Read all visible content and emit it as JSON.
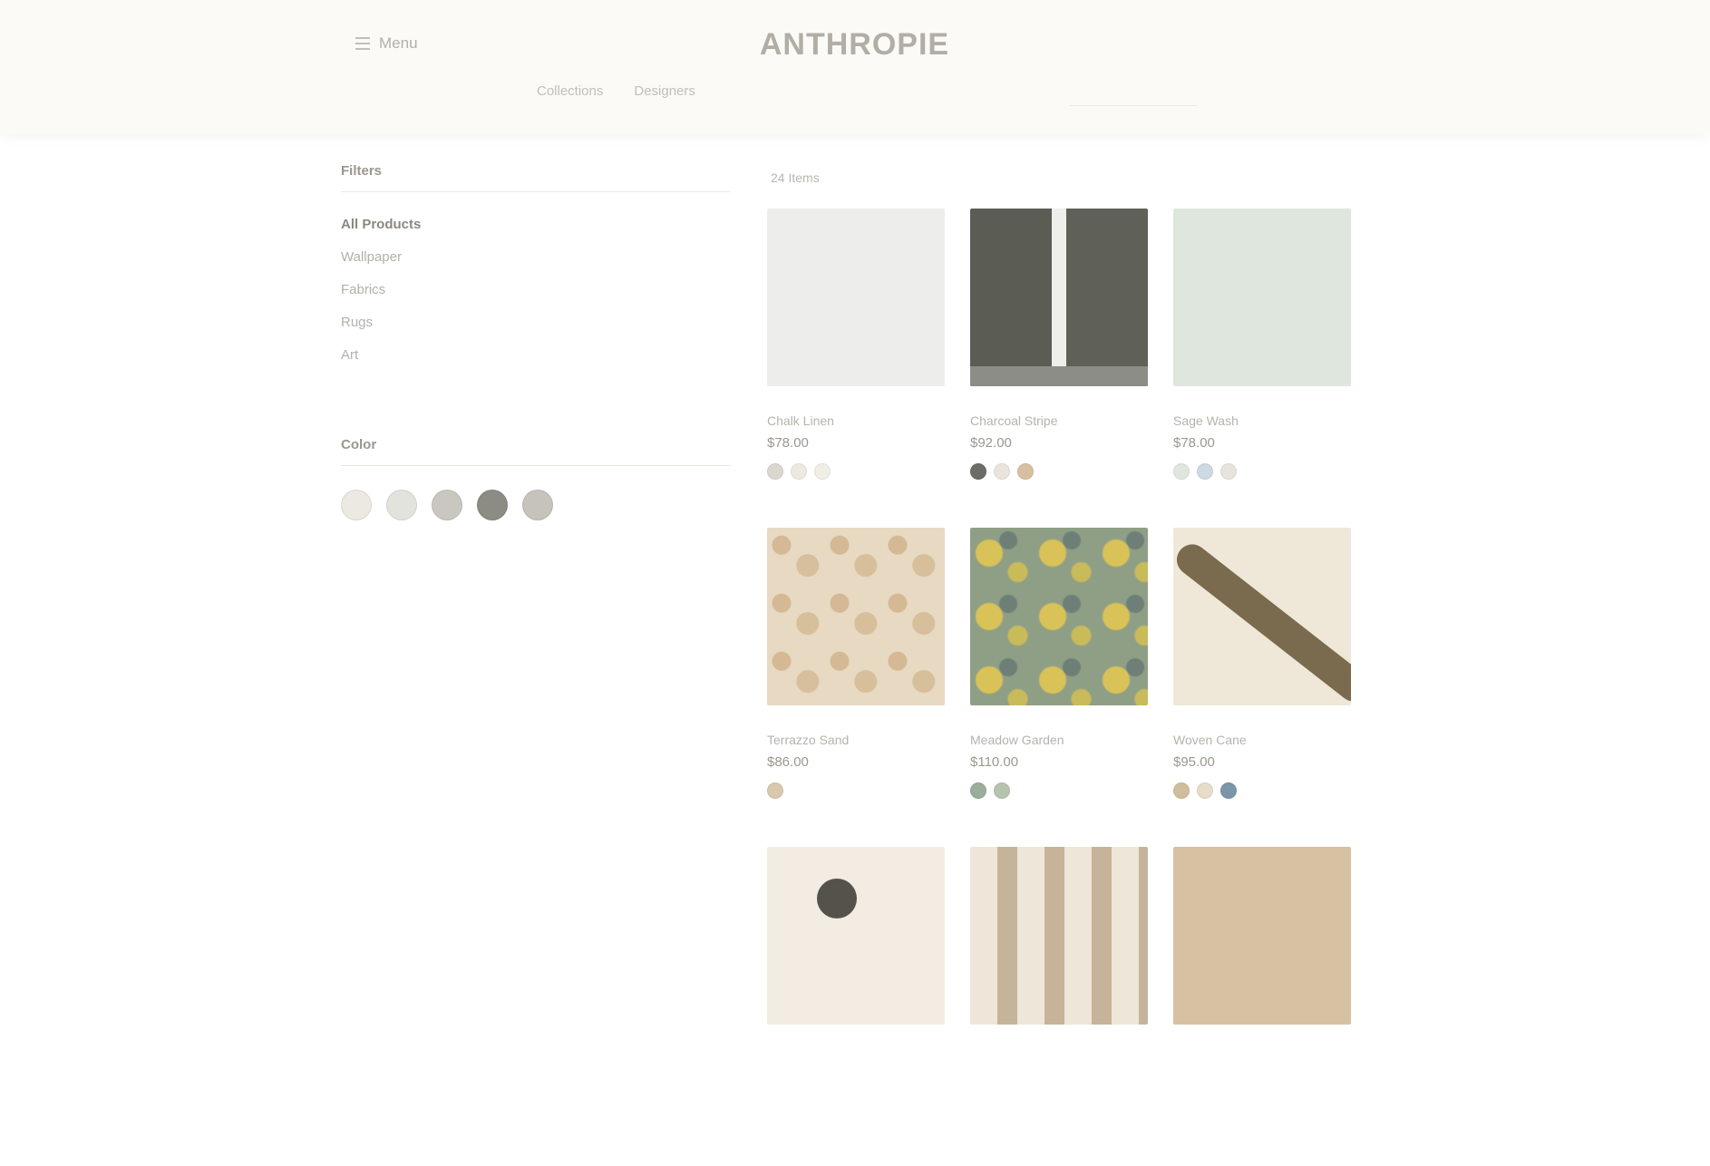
{
  "header": {
    "menu_label": "Menu",
    "logo": "ANTHROPIE",
    "subnav": [
      "Collections",
      "Designers"
    ]
  },
  "sidebar": {
    "heading": "Filters",
    "items": [
      {
        "label": "All Products",
        "active": true
      },
      {
        "label": "Wallpaper",
        "active": false
      },
      {
        "label": "Fabrics",
        "active": false
      },
      {
        "label": "Rugs",
        "active": false
      },
      {
        "label": "Art",
        "active": false
      }
    ],
    "color_heading": "Color",
    "swatch_colors": [
      "#ece9e3",
      "#e3e3de",
      "#c9c7bf",
      "#8c8c85",
      "#c6c3bb"
    ]
  },
  "results": {
    "count": "24 Items",
    "products": [
      {
        "name": "Chalk Linen",
        "price": "$78.00",
        "dots": [
          "#d9d7cf",
          "#ece9e1",
          "#f0eee6"
        ]
      },
      {
        "name": "Charcoal Stripe",
        "price": "$92.00",
        "dots": [
          "#6b6d66",
          "#e9e5dc",
          "#d7c0a0"
        ]
      },
      {
        "name": "Sage Wash",
        "price": "$78.00",
        "dots": [
          "#dfe6de",
          "#cdd9e3",
          "#e6e4dd"
        ]
      },
      {
        "name": "Terrazzo Sand",
        "price": "$86.00",
        "dots": [
          "#d9c8ae"
        ]
      },
      {
        "name": "Meadow Garden",
        "price": "$110.00",
        "dots": [
          "#9aae99",
          "#b7c4ad"
        ]
      },
      {
        "name": "Woven Cane",
        "price": "$95.00",
        "dots": [
          "#d0bd9d",
          "#e7dcc8",
          "#7b96a6"
        ]
      },
      {
        "name": "",
        "price": "",
        "dots": []
      },
      {
        "name": "",
        "price": "",
        "dots": []
      },
      {
        "name": "",
        "price": "",
        "dots": []
      }
    ]
  }
}
